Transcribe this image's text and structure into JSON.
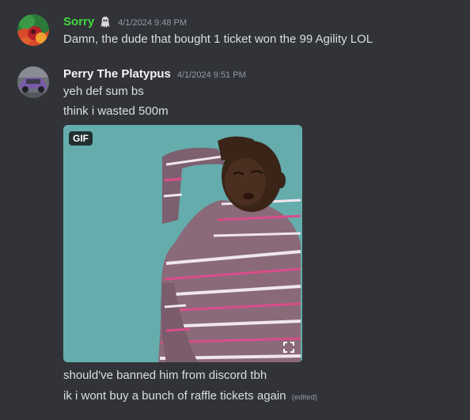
{
  "messages": [
    {
      "username": "Sorry",
      "username_color": "#3fd93f",
      "role_icon": "spooky-figure-icon",
      "timestamp": "4/1/2024 9:48 PM",
      "lines": [
        "Damn, the dude that bought 1 ticket won the 99 Agility LOL"
      ]
    },
    {
      "username": "Perry The Platypus",
      "username_color": "#f2f3f5",
      "timestamp": "4/1/2024 9:51 PM",
      "lines": [
        "yeh def sum bs",
        "think i wasted 500m"
      ],
      "attachment": {
        "type": "gif",
        "badge": "GIF",
        "expand_icon": "expand-icon"
      },
      "after_lines": [
        "should've banned him from discord tbh",
        "ik i wont buy a bunch of raffle tickets again"
      ],
      "edited_label": "(edited)"
    }
  ],
  "colors": {
    "background": "#313338",
    "text": "#dbdee1",
    "muted": "#949ba4"
  }
}
